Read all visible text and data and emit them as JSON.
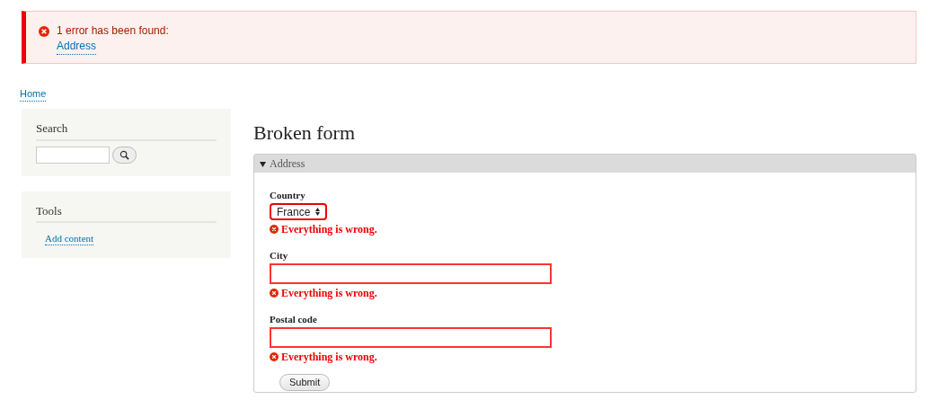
{
  "error_message": {
    "summary": "1 error has been found:",
    "links": [
      "Address"
    ]
  },
  "breadcrumb": [
    "Home"
  ],
  "sidebar": {
    "blocks": [
      {
        "kind": "search",
        "title": "Search"
      },
      {
        "kind": "links",
        "title": "Tools",
        "links": [
          "Add content"
        ]
      }
    ]
  },
  "page_title": "Broken form",
  "fieldset": {
    "legend": "Address",
    "expanded": true,
    "fields": [
      {
        "kind": "select",
        "label": "Country",
        "value": "France",
        "error": "Everything is wrong."
      },
      {
        "kind": "text",
        "label": "City",
        "error": "Everything is wrong."
      },
      {
        "kind": "text",
        "label": "Postal code",
        "error": "Everything is wrong."
      }
    ],
    "submit": "Submit"
  }
}
